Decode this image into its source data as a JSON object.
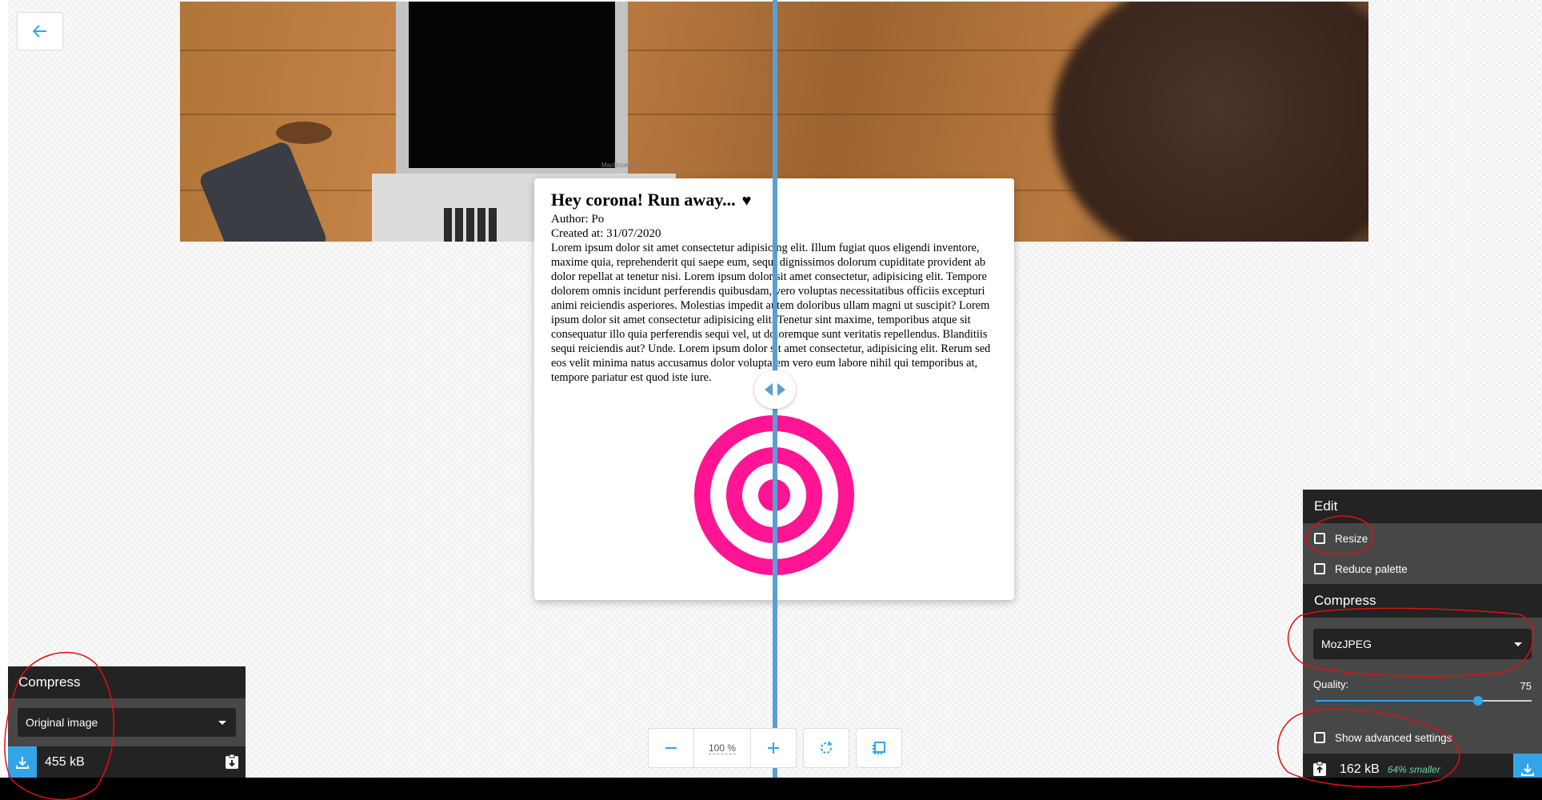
{
  "app": {
    "back_icon": "arrow-left-icon"
  },
  "post": {
    "title": "Hey corona! Run away...",
    "heart": "♥",
    "author": "Author: Po",
    "created": "Created at: 31/07/2020",
    "body": "Lorem ipsum dolor sit amet consectetur adipisicing elit. Illum fugiat quos eligendi inventore, maxime quia, reprehenderit qui saepe eum, sequi dignissimos dolorum cupiditate provident ab dolor repellat at tenetur nisi. Lorem ipsum dolor sit amet consectetur, adipisicing elit. Tempore dolorem omnis incidunt perferendis quibusdam, vero voluptas necessitatibus officiis excepturi animi reiciendis asperiores. Molestias impedit autem doloribus ullam magni ut suscipit? Lorem ipsum dolor sit amet consectetur adipisicing elit. Tenetur sint maxime, temporibus atque sit consequatur illo quia perferendis sequi vel, ut doloremque sunt veritatis repellendus. Blanditiis sequi reiciendis aut? Unde. Lorem ipsum dolor sit amet consectetur, adipisicing elit. Rerum sed eos velit minima natus accusamus dolor voluptatem vero eum labore nihil qui temporibus at, tempore pariatur est quod iste iure.",
    "banner_laptop_text": "MacBook Air"
  },
  "colors": {
    "accent": "#33a4e8",
    "divider": "#5a9fd4",
    "target": "#ff1493",
    "panel_dark": "#232323",
    "panel_mid": "#474747",
    "annotation": "#e01010"
  },
  "zoom": {
    "minus": "−",
    "level": "100 %",
    "plus": "+"
  },
  "left_panel": {
    "title": "Compress",
    "select_value": "Original image",
    "size": "455 kB"
  },
  "right_panel": {
    "edit_title": "Edit",
    "resize_label": "Resize",
    "reduce_palette_label": "Reduce palette",
    "compress_title": "Compress",
    "codec_value": "MozJPEG",
    "quality_label": "Quality:",
    "quality_value": "75",
    "quality_fraction": 0.75,
    "advanced_label": "Show advanced settings",
    "size": "162 kB",
    "saving": "64% smaller"
  }
}
